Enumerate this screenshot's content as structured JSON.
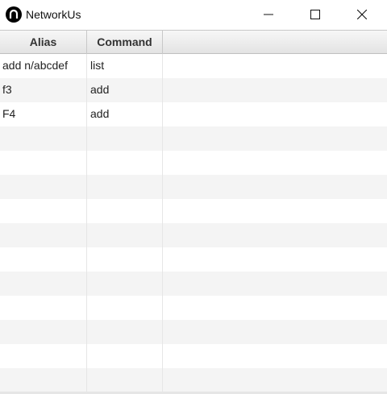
{
  "window": {
    "title": "NetworkUs",
    "icon": "app-logo-icon"
  },
  "table": {
    "columns": [
      "Alias",
      "Command"
    ],
    "rows": [
      {
        "alias": "add n/abcdef",
        "command": "list"
      },
      {
        "alias": "f3",
        "command": "add"
      },
      {
        "alias": "F4",
        "command": "add"
      },
      {
        "alias": "",
        "command": ""
      },
      {
        "alias": "",
        "command": ""
      },
      {
        "alias": "",
        "command": ""
      },
      {
        "alias": "",
        "command": ""
      },
      {
        "alias": "",
        "command": ""
      },
      {
        "alias": "",
        "command": ""
      },
      {
        "alias": "",
        "command": ""
      },
      {
        "alias": "",
        "command": ""
      },
      {
        "alias": "",
        "command": ""
      },
      {
        "alias": "",
        "command": ""
      },
      {
        "alias": "",
        "command": ""
      }
    ]
  }
}
